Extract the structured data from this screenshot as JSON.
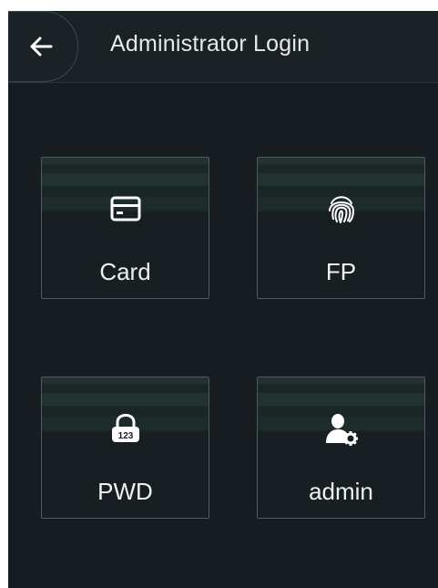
{
  "header": {
    "title": "Administrator Login"
  },
  "tiles": [
    {
      "label": "Card",
      "icon": "card-icon"
    },
    {
      "label": "FP",
      "icon": "fingerprint-icon"
    },
    {
      "label": "PWD",
      "icon": "password-lock-icon",
      "icon_text": "123"
    },
    {
      "label": "admin",
      "icon": "admin-user-gear-icon"
    }
  ],
  "colors": {
    "background": "#161c20",
    "header": "#1b2226",
    "tile_border": "#4f5b61",
    "text": "#f0f0f0"
  }
}
